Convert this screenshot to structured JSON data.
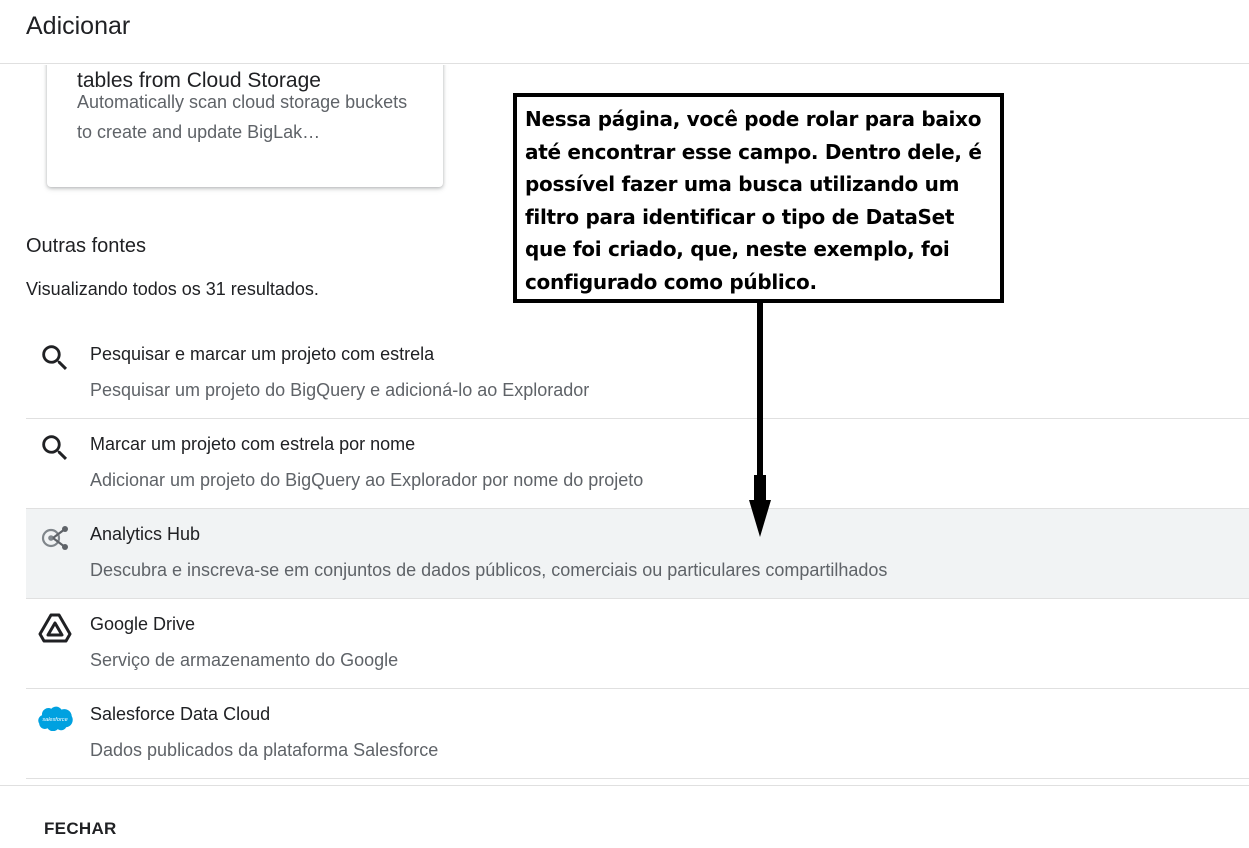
{
  "header": {
    "title": "Adicionar"
  },
  "card": {
    "title": "tables from Cloud Storage",
    "description": "Automatically scan cloud storage buckets to create and update BigLak…"
  },
  "section": {
    "title": "Outras fontes",
    "results": "Visualizando todos os 31 resultados."
  },
  "sources": [
    {
      "title": "Pesquisar e marcar um projeto com estrela",
      "description": "Pesquisar um projeto do BigQuery e adicioná-lo ao Explorador",
      "icon": "search-icon"
    },
    {
      "title": "Marcar um projeto com estrela por nome",
      "description": "Adicionar um projeto do BigQuery ao Explorador por nome do projeto",
      "icon": "search-icon"
    },
    {
      "title": "Analytics Hub",
      "description": "Descubra e inscreva-se em conjuntos de dados públicos, comerciais ou particulares compartilhados",
      "icon": "analytics-hub-icon"
    },
    {
      "title": "Google Drive",
      "description": "Serviço de armazenamento do Google",
      "icon": "google-drive-icon"
    },
    {
      "title": "Salesforce Data Cloud",
      "description": "Dados publicados da plataforma Salesforce",
      "icon": "salesforce-icon",
      "icon_text": "salesforce"
    }
  ],
  "footer": {
    "close_label": "FECHAR"
  },
  "annotation": {
    "text": "Nessa página, você pode rolar para baixo até encontrar esse campo. Dentro dele, é possível fazer uma busca utilizando um filtro para identificar o tipo de DataSet que foi criado, que, neste exemplo, foi configurado como público."
  },
  "colors": {
    "highlight": "#f1f3f4",
    "salesforce_blue": "#00a1e0",
    "secondary_text": "#5f6368"
  }
}
